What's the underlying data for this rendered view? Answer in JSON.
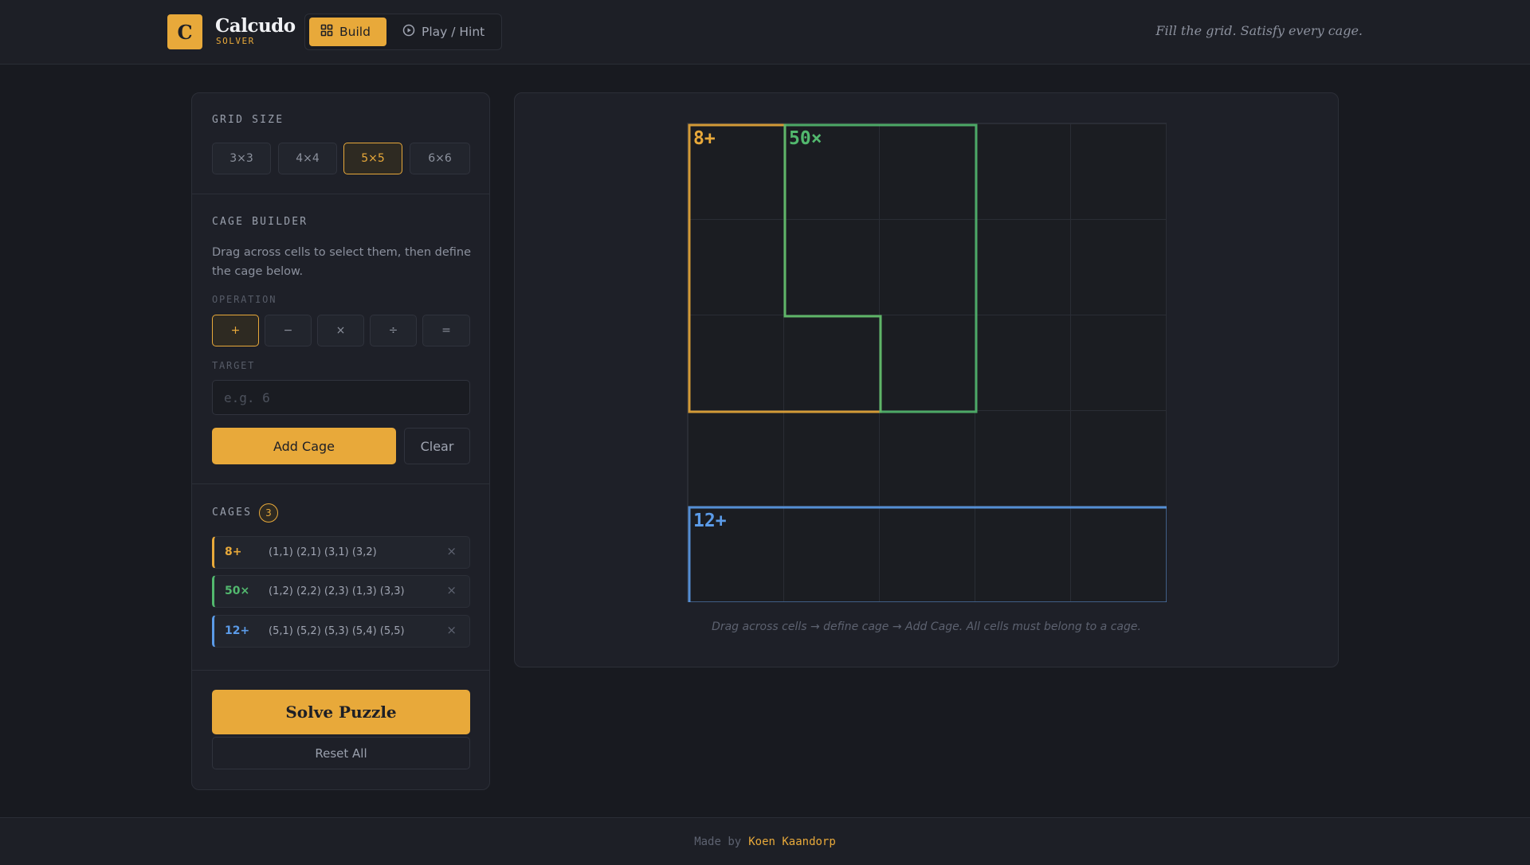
{
  "header": {
    "logo_letter": "C",
    "title": "Calcudo",
    "subtitle": "SOLVER",
    "modes": [
      {
        "label": "Build",
        "icon": "grid-icon",
        "active": true
      },
      {
        "label": "Play / Hint",
        "icon": "play-circle-icon",
        "active": false
      }
    ],
    "tagline": "Fill the grid. Satisfy every cage."
  },
  "sidebar": {
    "grid_size": {
      "label": "GRID SIZE",
      "options": [
        "3×3",
        "4×4",
        "5×5",
        "6×6"
      ],
      "selected": "5×5"
    },
    "cage_builder": {
      "label": "CAGE BUILDER",
      "help": "Drag across cells to select them, then define the cage below.",
      "operation_label": "OPERATION",
      "operations": [
        "+",
        "−",
        "×",
        "÷",
        "="
      ],
      "selected_operation": "+",
      "target_label": "TARGET",
      "target_value": "",
      "target_placeholder": "e.g. 6",
      "add_label": "Add Cage",
      "clear_label": "Clear"
    },
    "cages": {
      "label": "CAGES",
      "count": "3",
      "items": [
        {
          "label": "8+",
          "cells": "(1,1) (2,1) (3,1) (3,2)",
          "color": "#e8a93a"
        },
        {
          "label": "50×",
          "cells": "(1,2) (2,2) (2,3) (1,3) (3,3)",
          "color": "#52b86e"
        },
        {
          "label": "12+",
          "cells": "(5,1) (5,2) (5,3) (5,4) (5,5)",
          "color": "#5b9be8"
        }
      ],
      "remove_symbol": "×"
    },
    "solve_label": "Solve Puzzle",
    "reset_label": "Reset All"
  },
  "grid": {
    "size": 5,
    "cage_colors": {
      "8+": "#e8a93a",
      "50×": "#52b86e",
      "12+": "#5b9be8"
    },
    "cage_labels": [
      {
        "text": "8+",
        "color": "#e8a93a"
      },
      {
        "text": "50×",
        "color": "#52b86e"
      },
      {
        "text": "12+",
        "color": "#5b9be8"
      }
    ],
    "hint": "Drag across cells → define cage → Add Cage. All cells must belong to a cage."
  },
  "footer": {
    "made_by": "Made by",
    "author": "Koen Kaandorp"
  }
}
